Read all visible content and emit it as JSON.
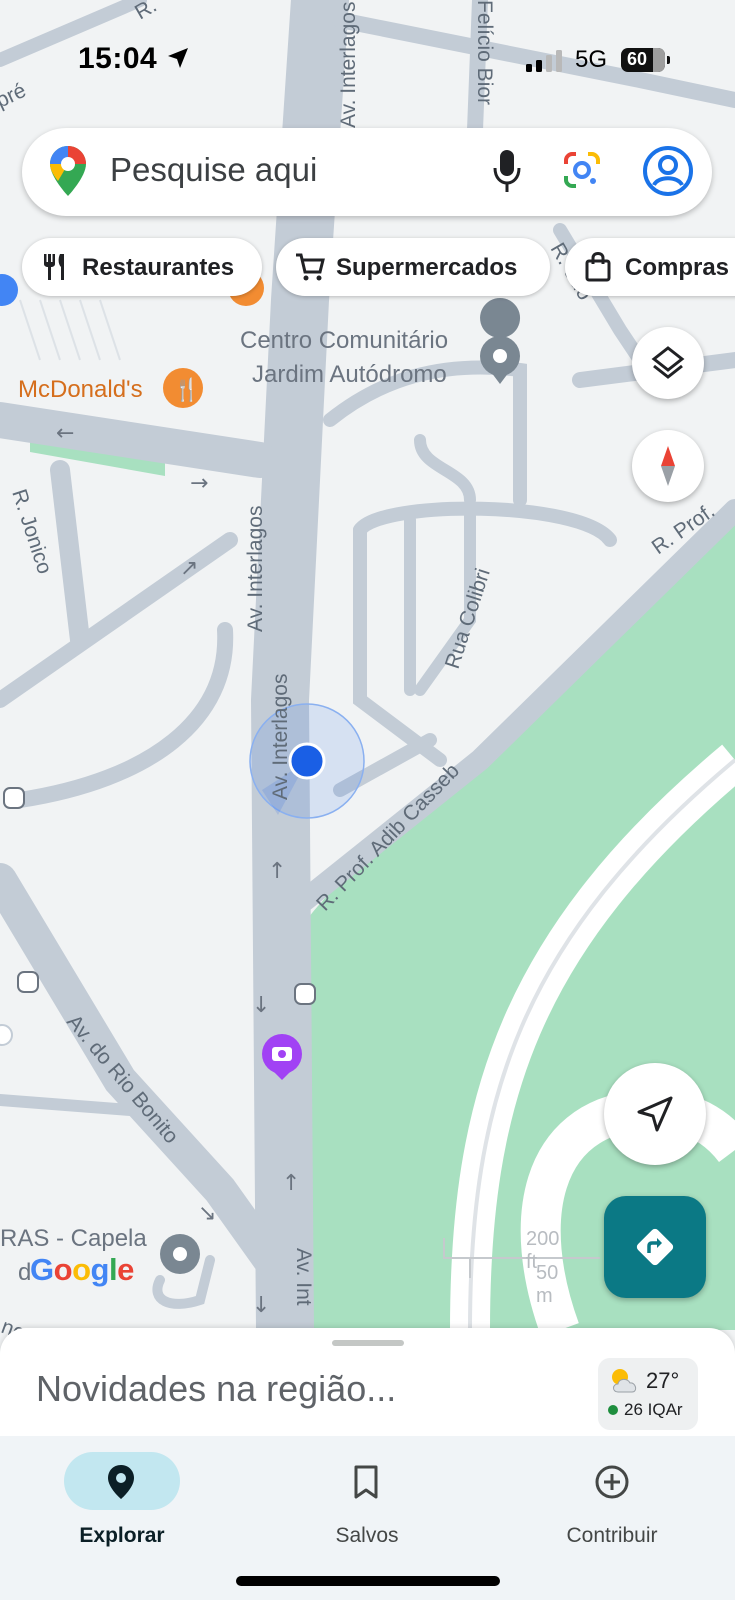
{
  "status_bar": {
    "time": "15:04",
    "network": "5G",
    "battery": "60"
  },
  "search": {
    "placeholder": "Pesquise aqui",
    "icons": [
      "maps-pin-icon",
      "microphone-icon",
      "google-lens-icon",
      "account-icon"
    ]
  },
  "chips": [
    {
      "label": "Restaurantes",
      "icon": "fork-knife-icon"
    },
    {
      "label": "Supermercados",
      "icon": "shopping-cart-icon"
    },
    {
      "label": "Compras",
      "icon": "shopping-bag-icon"
    }
  ],
  "map": {
    "labels": {
      "street_top_left": "R.",
      "street_top_left2": "pré",
      "av_interlagos_top": "Av. Interlagos",
      "av_interlagos_mid": "Av. Interlagos",
      "av_interlagos_loc": "Av. Interlagos",
      "av_interlagos_bottom": "Av. Int",
      "felicio": "Felício Bior",
      "r_jonico": "R. Jonico",
      "rua_colibri": "Rua Colibri",
      "r_prof_adib": "R. Prof. Adib Casseb",
      "r_prof_right": "R. Prof.",
      "r_rodo": "R. odo",
      "av_rio_bonito": "Av. do Rio Bonito",
      "centro_comunitario": "Centro Comunitário",
      "jardim_autodromo": "Jardim Autódromo",
      "mcdonalds": "McDonald's",
      "capela": "RAS - Capela",
      "capela2": "d",
      "bottom_left": "no",
      "scale_ft": "200 ft",
      "scale_m": "50 m"
    },
    "google_logo": "Google",
    "colors": {
      "road": "#c3ccd6",
      "park": "#a8e0c0",
      "background": "#f1f3f4",
      "location_dot": "#1a5fe5"
    }
  },
  "controls": {
    "icons": [
      "layers-icon",
      "compass-icon",
      "my-location-icon",
      "directions-icon"
    ]
  },
  "sheet": {
    "title": "Novidades na região...",
    "temperature": "27°",
    "aqi": "26 IQAr"
  },
  "bottom_nav": [
    {
      "label": "Explorar",
      "icon": "explore-pin-icon",
      "active": true
    },
    {
      "label": "Salvos",
      "icon": "bookmark-icon",
      "active": false
    },
    {
      "label": "Contribuir",
      "icon": "add-circle-icon",
      "active": false
    }
  ]
}
